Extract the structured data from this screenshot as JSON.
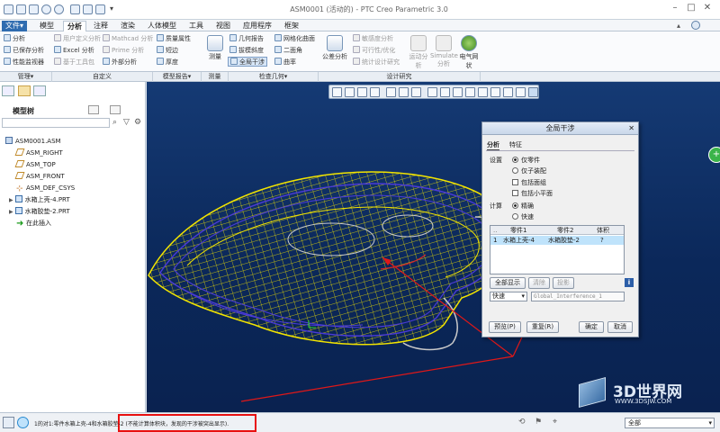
{
  "window": {
    "title": "ASM0001 (活动的) - PTC Creo Parametric 3.0"
  },
  "menu_tabs": [
    {
      "label": "文件▾"
    },
    {
      "label": "模型"
    },
    {
      "label": "分析"
    },
    {
      "label": "注释"
    },
    {
      "label": "渲染"
    },
    {
      "label": "人体模型"
    },
    {
      "label": "工具"
    },
    {
      "label": "视图"
    },
    {
      "label": "应用程序"
    },
    {
      "label": "框架"
    }
  ],
  "ribbon": {
    "manage": [
      "分析",
      "已保存分析",
      "性能监视器"
    ],
    "custom": [
      "用户定义分析",
      "Excel 分析",
      "基于工具包",
      "Mathcad 分析",
      "Prime 分析",
      "外部分析"
    ],
    "inspect_model": [
      "质量属性",
      "短边",
      "厚度"
    ],
    "measure": "测量",
    "check_geometry": [
      "几何报告",
      "拔模斜度",
      "全局干涉",
      "网格化曲面",
      "二面角",
      "曲率"
    ],
    "design_study": [
      "公差分析",
      "敏感度分析",
      "可行性/优化",
      "统计设计研究"
    ],
    "design_big": [
      "运动分析",
      "Simulate 分析",
      "电气网状"
    ]
  },
  "group_labels": [
    "管理▾",
    "自定义",
    "模型报告▾",
    "测量",
    "检查几何▾",
    "设计研究"
  ],
  "model_tree": {
    "title": "模型树",
    "root": "ASM0001.ASM",
    "items": [
      "ASM_RIGHT",
      "ASM_TOP",
      "ASM_FRONT",
      "ASM_DEF_CSYS",
      "水箱上壳-4.PRT",
      "水箱胶垫-2.PRT",
      "在此插入"
    ]
  },
  "dialog": {
    "title": "全局干涉",
    "tabs": [
      "分析",
      "特征"
    ],
    "settings_label": "设置",
    "settings_options": [
      "仅零件",
      "仅子装配"
    ],
    "checks": [
      "包括面组",
      "包括小平面"
    ],
    "compute_label": "计算",
    "compute_options": [
      "精确",
      "快速"
    ],
    "columns": [
      "零件1",
      "零件2",
      "体积"
    ],
    "row": {
      "index": "1",
      "part1": "水箱上壳-4",
      "part2": "水箱胶垫-2",
      "volume": "?"
    },
    "buttons_mid": [
      "全部显示",
      "清除",
      "投影"
    ],
    "speed_select": "快速",
    "name_field": "Global_Interference_1",
    "buttons_bottom": [
      "预览(P)",
      "重复(R)",
      "确定",
      "取消"
    ]
  },
  "status": {
    "message": "1的对1:零件水箱上壳-4和水箱胶垫-2 (不能计算体积块，发现的干涉被突出显示).",
    "filter": "全部"
  },
  "watermark": {
    "brand": "3D世界网",
    "url": "WWW.3DSJW.COM"
  },
  "colors": {
    "highlight_box": "#e81010",
    "arrow": "#e01818",
    "model_yellow": "#f2e400",
    "model_blue": "#4a3ad8"
  }
}
